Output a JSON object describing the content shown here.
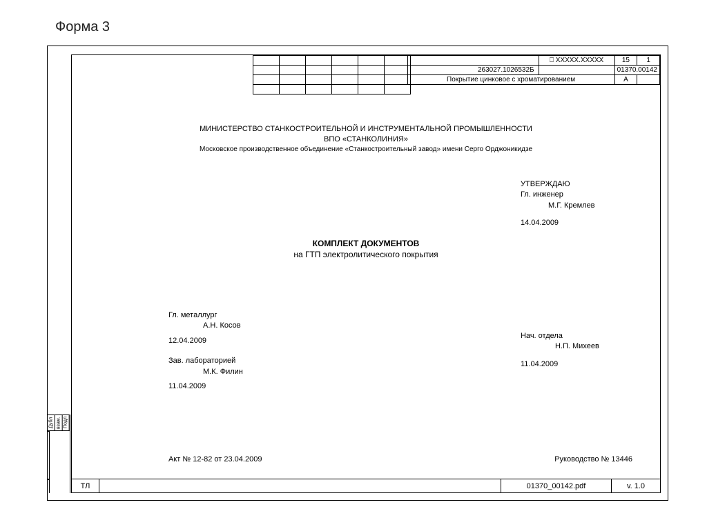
{
  "page_label": "Форма 3",
  "header": {
    "row1": {
      "code_box": "ХХХХХ.ХХХХХ",
      "num1": "15",
      "num2": "1"
    },
    "row2": {
      "left_code": "263027.1026532Б",
      "right_code": "01370.00142"
    },
    "row3": {
      "desc": "Покрытие цинковое с хроматированием",
      "letter": "А"
    }
  },
  "ministry": {
    "line1": "МИНИСТЕРСТВО СТАНКОСТРОИТЕЛЬНОЙ И ИНСТРУМЕНТАЛЬНОЙ ПРОМЫШЛЕННОСТИ",
    "line2": "ВПО «СТАНКОЛИНИЯ»",
    "line3": "Московское производственное объединение «Станкостроительный завод» имени Серго Орджоникидзе"
  },
  "approve": {
    "title": "УТВЕРЖДАЮ",
    "position": "Гл. инженер",
    "name": "М.Г. Кремлев",
    "date": "14.04.2009"
  },
  "doc_title": {
    "line1": "КОМПЛЕКТ ДОКУМЕНТОВ",
    "line2": "на ГТП электролитического покрытия"
  },
  "left_signers": {
    "s1_pos": "Гл. металлург",
    "s1_name": "А.Н. Косов",
    "s1_date": "12.04.2009",
    "s2_pos": "Зав. лабораторией",
    "s2_name": "М.К. Филин",
    "s2_date": "11.04.2009"
  },
  "right_signer": {
    "pos": "Нач. отдела",
    "name": "Н.П. Михеев",
    "date": "11.04.2009"
  },
  "akt": "Акт № 12-82 от 23.04.2009",
  "ruk": "Руководство № 13446",
  "footer": {
    "tl": "ТЛ",
    "file": "01370_00142.pdf",
    "ver": "v. 1.0"
  },
  "side": {
    "g1": "Дубл",
    "g2": "взам.",
    "g3": "Подл"
  }
}
